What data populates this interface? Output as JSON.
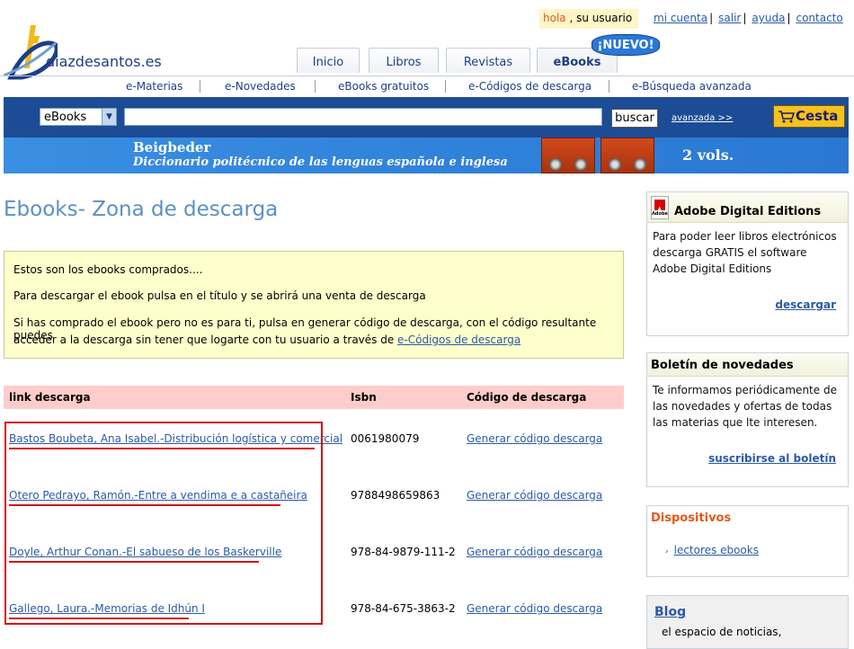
{
  "header": {
    "logo_text": "diazdesantos.es",
    "greeting_hello": "hola",
    "greeting_rest": " , su usuario",
    "toplinks": [
      "mi cuenta",
      "salir",
      "ayuda",
      "contacto"
    ],
    "tabs": [
      "Inicio",
      "Libros",
      "Revistas",
      "eBooks"
    ],
    "nuevo_badge": "¡NUEVO!",
    "subnav": [
      "e-Materias",
      "e-Novedades",
      "eBooks gratuitos",
      "e-Códigos de descarga",
      "e-Búsqueda avanzada"
    ]
  },
  "search": {
    "category_selected": "eBooks",
    "query": "",
    "button_label": "buscar",
    "advanced_link": "avanzada >>",
    "cart_label": "Cesta"
  },
  "banner": {
    "author": "Beigbeder",
    "title": "Diccionario politécnico de las lenguas española e inglesa",
    "volumes": "2 vols."
  },
  "main": {
    "page_title": "Ebooks- Zona de descarga",
    "info": {
      "line1": "Estos son los ebooks comprados....",
      "line2": "Para descargar el ebook pulsa en el título y se abrirá una venta de descarga",
      "line3a": "Si has comprado el ebook pero no es para ti, pulsa en generar código de descarga, con el código resultante puedes",
      "line3b": "acceder a la descarga sin tener que logarte con tu usuario a través de ",
      "line3_link": "e-Códigos de descarga"
    },
    "table": {
      "headers": [
        "link descarga",
        "Isbn",
        "Código de descarga"
      ],
      "rows": [
        {
          "title": "Bastos Boubeta, Ana Isabel.-Distribución logística y comercial",
          "isbn": "0061980079",
          "code": "Generar código descarga"
        },
        {
          "title": "Otero Pedrayo, Ramón.-Entre a vendima e a castañeira",
          "isbn": "9788498659863",
          "code": "Generar código descarga"
        },
        {
          "title": "Doyle, Arthur Conan.-El sabueso de los Baskerville",
          "isbn": "978-84-9879-111-2",
          "code": "Generar código descarga"
        },
        {
          "title": "Gallego, Laura.-Memorias de Idhún I",
          "isbn": "978-84-675-3863-2",
          "code": "Generar código descarga"
        }
      ]
    }
  },
  "sidebar": {
    "adobe": {
      "title": "Adobe Digital Editions",
      "body": "Para poder leer libros electrónicos descarga GRATIS el software Adobe Digital Editions",
      "link": "descargar"
    },
    "boletin": {
      "title": "Boletín de novedades",
      "body": "Te informamos periódicamente de las novedades y ofertas de todas las materias que lte interesen.",
      "link": "suscribirse al boletín"
    },
    "dispositivos": {
      "title": "Dispositivos",
      "link": "lectores ebooks"
    },
    "blog": {
      "title": "Blog",
      "body": "el espacio de noticias,"
    }
  },
  "colors": {
    "brand_blue": "#1c4c96",
    "title_blue": "#5b8fc8",
    "highlight_red": "#d41111",
    "header_orange": "#e15a1a"
  }
}
